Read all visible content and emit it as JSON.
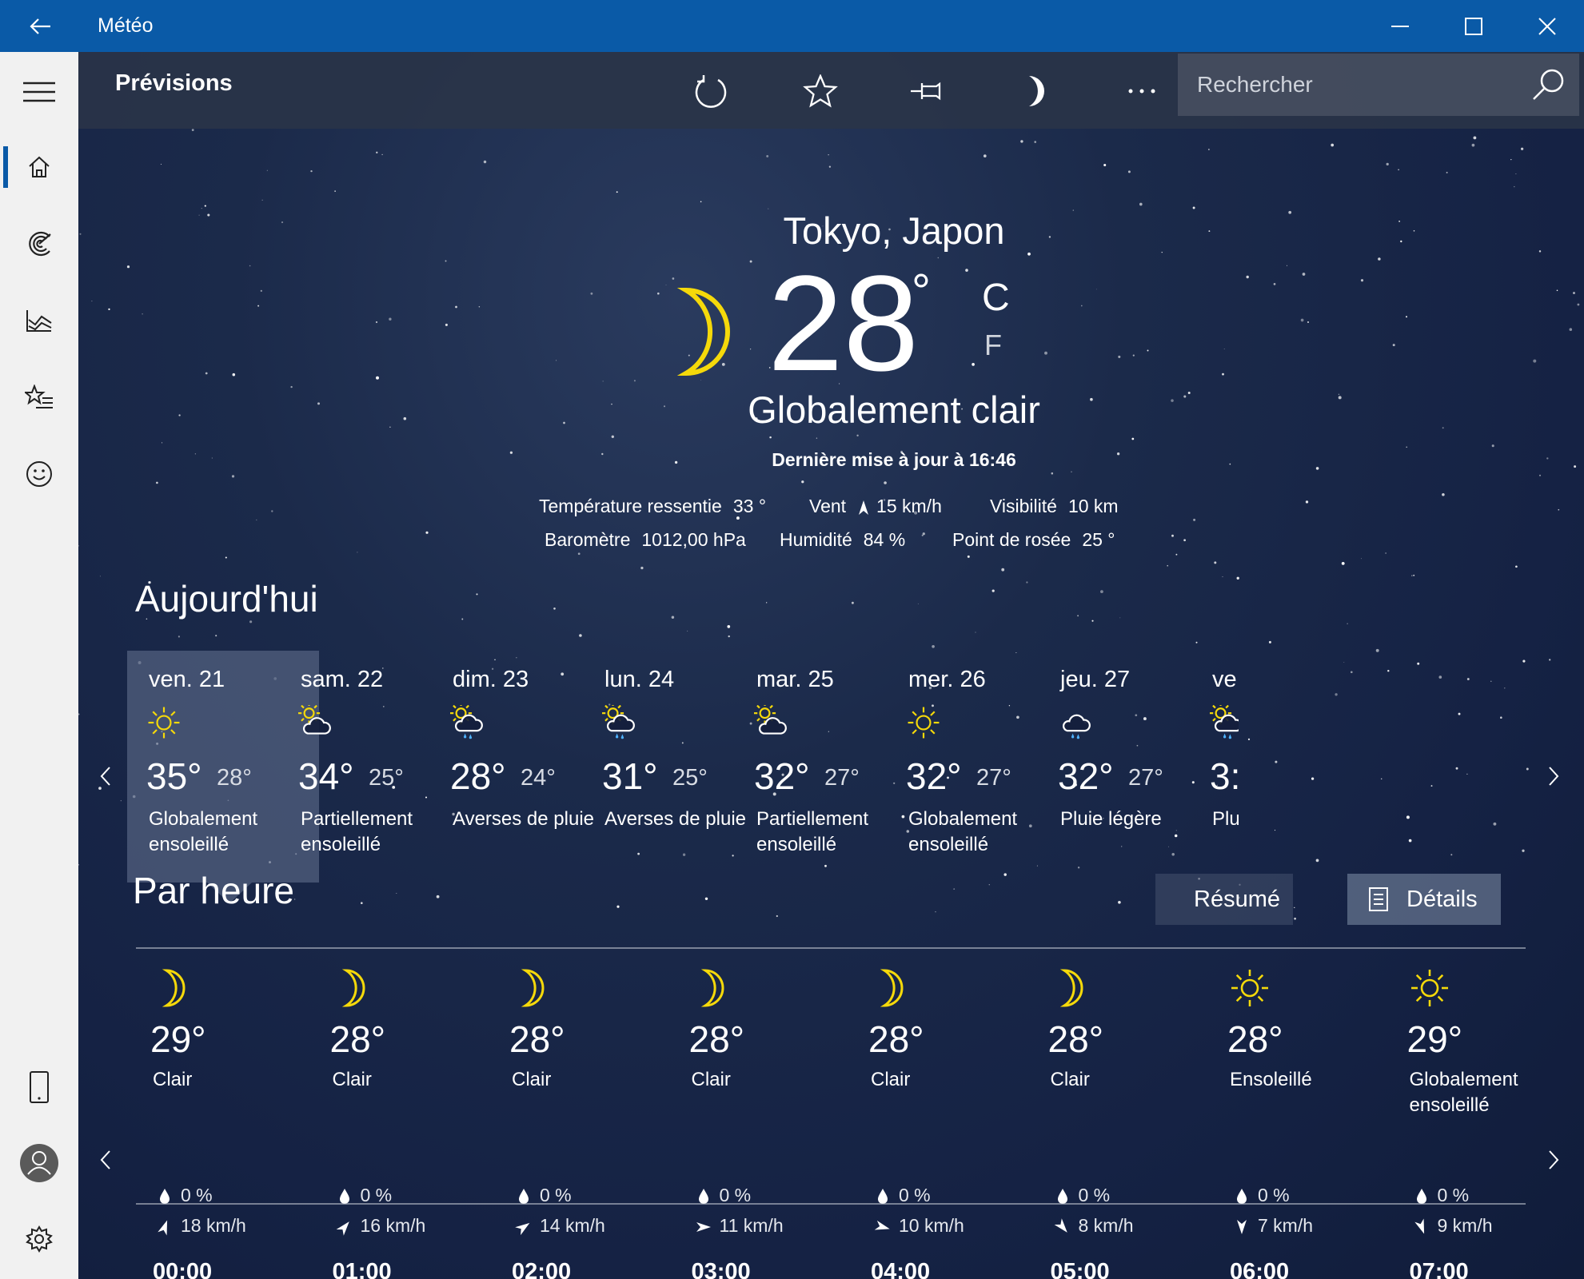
{
  "window": {
    "title": "Météo"
  },
  "header": {
    "title": "Prévisions",
    "search_placeholder": "Rechercher"
  },
  "current": {
    "location": "Tokyo, Japon",
    "temperature": "28",
    "degree": "°",
    "unit_c": "C",
    "unit_f": "F",
    "condition": "Globalement clair",
    "updated": "Dernière mise à jour à 16:46",
    "details": {
      "feels_label": "Température ressentie",
      "feels_value": "33 °",
      "wind_label": "Vent",
      "wind_value": "15 km/h",
      "visibility_label": "Visibilité",
      "visibility_value": "10 km",
      "barometer_label": "Baromètre",
      "barometer_value": "1012,00 hPa",
      "humidity_label": "Humidité",
      "humidity_value": "84 %",
      "dew_label": "Point de rosée",
      "dew_value": "25 °"
    }
  },
  "today": {
    "title": "Aujourd'hui",
    "days": [
      {
        "day": "ven. 21",
        "icon": "sun-icon",
        "high": "35°",
        "low": "28°",
        "condition": "Globalement ensoleillé"
      },
      {
        "day": "sam. 22",
        "icon": "partly-cloudy-icon",
        "high": "34°",
        "low": "25°",
        "condition": "Partiellement ensoleillé"
      },
      {
        "day": "dim. 23",
        "icon": "sun-showers-icon",
        "high": "28°",
        "low": "24°",
        "condition": "Averses de pluie"
      },
      {
        "day": "lun. 24",
        "icon": "sun-showers-icon",
        "high": "31°",
        "low": "25°",
        "condition": "Averses de pluie"
      },
      {
        "day": "mar. 25",
        "icon": "partly-cloudy-icon",
        "high": "32°",
        "low": "27°",
        "condition": "Partiellement ensoleillé"
      },
      {
        "day": "mer. 26",
        "icon": "sun-icon",
        "high": "32°",
        "low": "27°",
        "condition": "Globalement ensoleillé"
      },
      {
        "day": "jeu. 27",
        "icon": "rain-cloud-icon",
        "high": "32°",
        "low": "27°",
        "condition": "Pluie légère"
      },
      {
        "day": "ve",
        "icon": "sun-showers-icon",
        "high": "3:",
        "low": "",
        "condition": "Plu"
      }
    ]
  },
  "hourly": {
    "title": "Par heure",
    "summary_label": "Résumé",
    "details_label": "Détails",
    "hours": [
      {
        "time": "00:00",
        "icon": "moon-icon",
        "temp": "29°",
        "condition": "Clair",
        "precip": "0 %",
        "wind": "18 km/h",
        "wind_dir": 20
      },
      {
        "time": "01:00",
        "icon": "moon-icon",
        "temp": "28°",
        "condition": "Clair",
        "precip": "0 %",
        "wind": "16 km/h",
        "wind_dir": 40
      },
      {
        "time": "02:00",
        "icon": "moon-icon",
        "temp": "28°",
        "condition": "Clair",
        "precip": "0 %",
        "wind": "14 km/h",
        "wind_dir": 55
      },
      {
        "time": "03:00",
        "icon": "moon-icon",
        "temp": "28°",
        "condition": "Clair",
        "precip": "0 %",
        "wind": "11 km/h",
        "wind_dir": 90
      },
      {
        "time": "04:00",
        "icon": "moon-icon",
        "temp": "28°",
        "condition": "Clair",
        "precip": "0 %",
        "wind": "10 km/h",
        "wind_dir": 105
      },
      {
        "time": "05:00",
        "icon": "moon-icon",
        "temp": "28°",
        "condition": "Clair",
        "precip": "0 %",
        "wind": "8 km/h",
        "wind_dir": 140
      },
      {
        "time": "06:00",
        "icon": "sun-icon",
        "temp": "28°",
        "condition": "Ensoleillé",
        "precip": "0 %",
        "wind": "7 km/h",
        "wind_dir": 180
      },
      {
        "time": "07:00",
        "icon": "sun-icon",
        "temp": "29°",
        "condition": "Globalement ensoleillé",
        "precip": "0 %",
        "wind": "9 km/h",
        "wind_dir": 160
      }
    ]
  },
  "colors": {
    "accent": "#0a5aa7",
    "sun": "#f5d90a",
    "rain": "#4fb3ff"
  }
}
